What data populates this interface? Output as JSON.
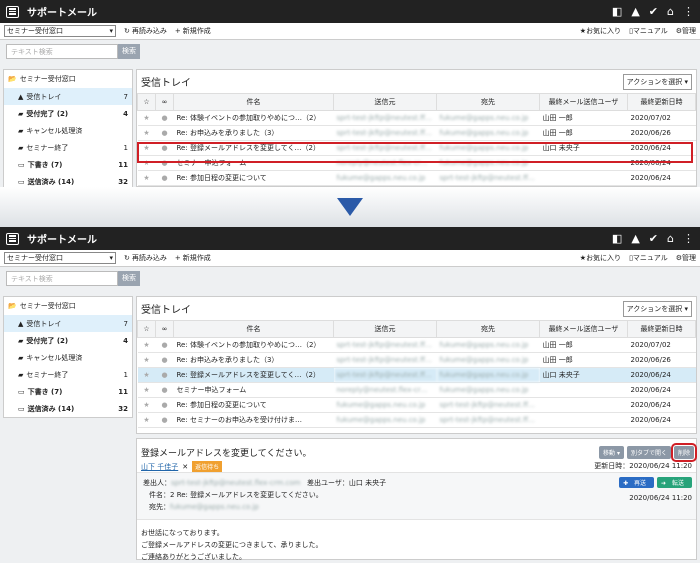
{
  "app": {
    "title": "サポートメール",
    "icons": [
      "bookmark-icon",
      "bell-icon",
      "check-icon",
      "home-icon",
      "more-vert-icon"
    ]
  },
  "toolbar": {
    "select": "セミナー受付窓口",
    "reload": "再読み込み",
    "new": "新規作成",
    "favorite": "お気に入り",
    "manual": "マニュアル",
    "admin": "管理"
  },
  "search": {
    "placeholder": "テキスト検索",
    "button": "検索"
  },
  "sidebar": {
    "root": "セミナー受付窓口",
    "items": [
      {
        "label": "受信トレイ",
        "count": "7"
      },
      {
        "label": "受付完了 (2)",
        "count": "4"
      },
      {
        "label": "キャンセル処理済",
        "count": ""
      },
      {
        "label": "セミナー終了",
        "count": "1"
      },
      {
        "label": "下書き (7)",
        "count": "11"
      },
      {
        "label": "送信済み (14)",
        "count": "32"
      }
    ]
  },
  "main": {
    "title": "受信トレイ",
    "action": "アクションを選択",
    "headers": [
      "件名",
      "送信元",
      "宛先",
      "最終メール送信ユーザ",
      "最終更新日時"
    ],
    "rows": [
      {
        "subject": "Re: 体験イベントの参加取りやめにつ…（2）",
        "from": "sprt-test-jkftp@neutest.ff…",
        "to": "fukume@gapps.neu.co.jp",
        "user": "山田 一郎",
        "date": "2020/07/02"
      },
      {
        "subject": "Re: お申込みを承りました（3）",
        "from": "sprt-test-jkftp@neutest.ff…",
        "to": "fukume@gapps.neu.co.jp",
        "user": "山田 一郎",
        "date": "2020/06/26"
      },
      {
        "subject": "Re: 登録メールアドレスを変更してく…（2）",
        "from": "sprt-test-jkftp@neutest.ff…",
        "to": "fukume@gapps.neu.co.jp",
        "user": "山口 未央子",
        "date": "2020/06/24"
      },
      {
        "subject": "セミナー申込フォーム",
        "from": "noreply@neutest.flex-crm.com",
        "to": "fukume@gapps.neu.co.jp",
        "user": "",
        "date": "2020/06/24"
      },
      {
        "subject": "Re: 参加日程の変更について",
        "from": "fukume@gapps.neu.co.jp",
        "to": "sprt-test-jkftp@neutest.ff…",
        "user": "",
        "date": "2020/06/24"
      },
      {
        "subject": "Re: セミナーのお申込みを受け付けま…",
        "from": "fukume@gapps.neu.co.jp",
        "to": "sprt-test-jkftp@neutest.ff…",
        "user": "",
        "date": "2020/06/24"
      }
    ]
  },
  "detail": {
    "subject": "登録メールアドレスを変更してください。",
    "assignee": "山下 千佳子",
    "status": "返信待ち",
    "updated": "更新日時：2020/06/24 11:20",
    "btn_move": "移動",
    "btn_tab": "別タブで開く",
    "btn_delete": "削除",
    "btn_resend": "再送",
    "btn_forward": "転送",
    "from_label": "差出人：",
    "from_value": "sprt-test-jkftp@neutest.flex-crm.com",
    "sender_user": "差出ユーザ：山口 未央子",
    "subj_label": "件名：2",
    "subj_value": "Re: 登録メールアドレスを変更してください。",
    "mail_date": "2020/06/24 11:20",
    "to_label": "宛先：",
    "to_value": "fukume@gapps.neu.co.jp",
    "body": [
      "お世話になっております。",
      "ご登録メールアドレスの変更につきまして、承りました。",
      "ご連絡ありがとうございました。"
    ]
  },
  "colors": {
    "accent": "#d01f26",
    "topbar": "#222222",
    "selected": "#d6ebf7"
  }
}
